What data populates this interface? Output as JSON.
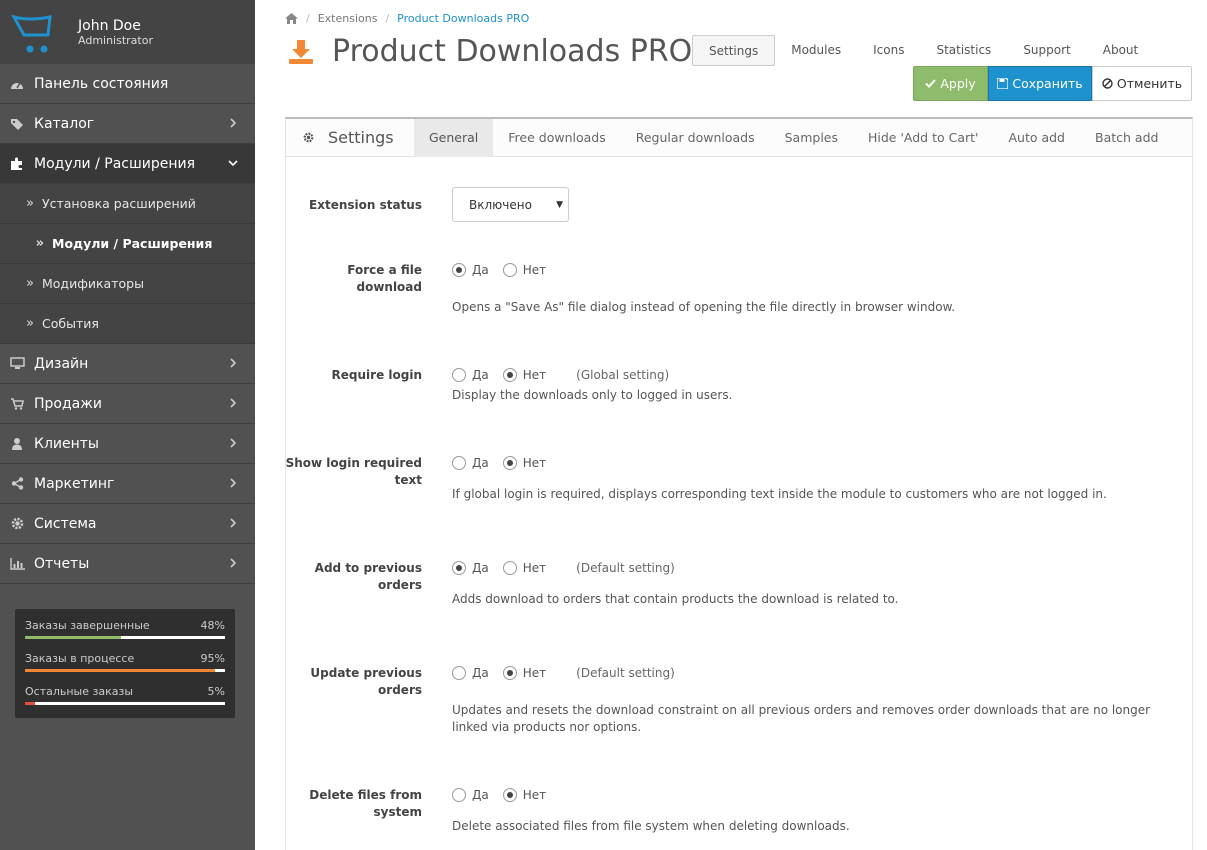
{
  "profile": {
    "name": "John Doe",
    "role": "Administrator"
  },
  "sidebar": {
    "items": [
      {
        "label": "Панель состояния",
        "icon": "dashboard-icon"
      },
      {
        "label": "Каталог",
        "icon": "tag-icon"
      },
      {
        "label": "Модули / Расширения",
        "icon": "puzzle-icon"
      },
      {
        "label": "Дизайн",
        "icon": "monitor-icon"
      },
      {
        "label": "Продажи",
        "icon": "cart-icon"
      },
      {
        "label": "Клиенты",
        "icon": "user-icon"
      },
      {
        "label": "Маркетинг",
        "icon": "share-icon"
      },
      {
        "label": "Система",
        "icon": "gear-icon"
      },
      {
        "label": "Отчеты",
        "icon": "bar-chart-icon"
      }
    ],
    "subitems": [
      {
        "label": "Установка расширений"
      },
      {
        "label": "Модули / Расширения"
      },
      {
        "label": "Модификаторы"
      },
      {
        "label": "События"
      }
    ],
    "stats": [
      {
        "label": "Заказы завершенные",
        "value": "48%",
        "fraction": 0.48,
        "color": "#8fbb6c"
      },
      {
        "label": "Заказы в процессе",
        "value": "95%",
        "fraction": 0.95,
        "color": "#f38733"
      },
      {
        "label": "Остальные заказы",
        "value": "5%",
        "fraction": 0.05,
        "color": "#e3503e"
      }
    ]
  },
  "breadcrumb": {
    "home_icon": "home-icon",
    "items": [
      "Extensions",
      "Product Downloads PRO"
    ]
  },
  "header": {
    "title": "Product Downloads PRO",
    "icon": "download-icon"
  },
  "topnav": [
    "Settings",
    "Modules",
    "Icons",
    "Statistics",
    "Support",
    "About"
  ],
  "actions": {
    "apply": "Apply",
    "save": "Сохранить",
    "cancel": "Отменить"
  },
  "panel": {
    "title": "Settings",
    "tabs": [
      "General",
      "Free downloads",
      "Regular downloads",
      "Samples",
      "Hide 'Add to Cart'",
      "Auto add",
      "Batch add"
    ]
  },
  "form": {
    "yes": "Да",
    "no": "Нет",
    "extension_status": {
      "label": "Extension status",
      "value": "Включено"
    },
    "force_download": {
      "label": "Force a file download",
      "help": "Opens a \"Save As\" file dialog instead of opening the file directly in browser window."
    },
    "require_login": {
      "label": "Require login",
      "note": "(Global setting)",
      "help": "Display the downloads only to logged in users."
    },
    "show_login_text": {
      "label": "Show login required text",
      "help": "If global login is required, displays corresponding text inside the module to customers who are not logged in."
    },
    "add_previous": {
      "label": "Add to previous orders",
      "note": "(Default setting)",
      "help": "Adds download to orders that contain products the download is related to."
    },
    "update_previous": {
      "label": "Update previous orders",
      "note": "(Default setting)",
      "help": "Updates and resets the download constraint on all previous orders and removes order downloads that are no longer linked via products nor options."
    },
    "delete_files": {
      "label": "Delete files from system",
      "help": "Delete associated files from file system when deleting downloads."
    }
  },
  "colors": {
    "accent": "#1e91cf",
    "success": "#8fbb6c",
    "download_icon": "#f38733"
  }
}
